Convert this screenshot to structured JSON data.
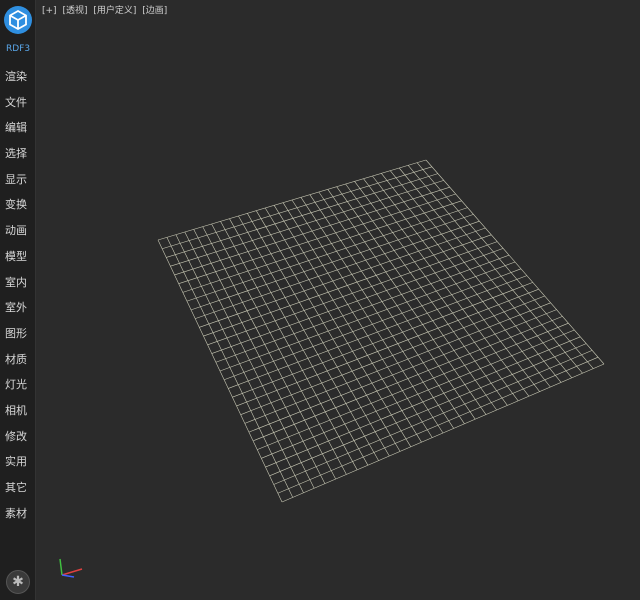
{
  "app": {
    "brand": "RDF3",
    "logo_icon": "cube-logo-icon"
  },
  "sidebar": {
    "items": [
      {
        "label": "渲染"
      },
      {
        "label": "文件"
      },
      {
        "label": "编辑"
      },
      {
        "label": "选择"
      },
      {
        "label": "显示"
      },
      {
        "label": "变换"
      },
      {
        "label": "动画"
      },
      {
        "label": "模型"
      },
      {
        "label": "室内"
      },
      {
        "label": "室外"
      },
      {
        "label": "图形"
      },
      {
        "label": "材质"
      },
      {
        "label": "灯光"
      },
      {
        "label": "相机"
      },
      {
        "label": "修改"
      },
      {
        "label": "实用"
      },
      {
        "label": "其它"
      },
      {
        "label": "素材"
      }
    ],
    "settings_icon": "gear-icon"
  },
  "viewport": {
    "labels": {
      "plus": "[+]",
      "view": "[透视]",
      "shading": "[用户定义]",
      "display": "[边画]"
    },
    "grid": {
      "divisions": 30,
      "wire_color": "#c9c9b5"
    },
    "background": "#2b2b2b",
    "axis_colors": {
      "x": "#e04040",
      "y": "#40c040",
      "z": "#4060ff"
    }
  }
}
